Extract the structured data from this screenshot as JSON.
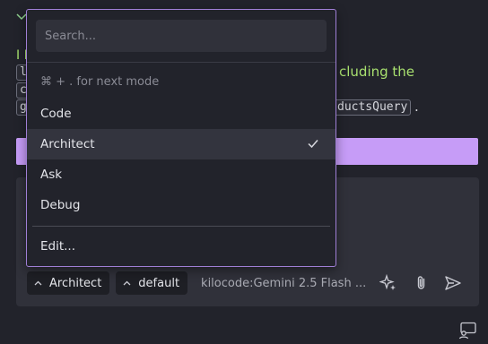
{
  "background": {
    "chevron": "✓",
    "text_line_end": "cluding the",
    "code_chip_tail": "ductsQuery",
    "period": "."
  },
  "composer": {
    "mode_pill": "Architect",
    "profile_pill": "default",
    "model": "kilocode:Gemini 2.5 Flash ..."
  },
  "dropdown": {
    "search_placeholder": "Search...",
    "hint": "⌘ + . for next mode",
    "items": [
      {
        "label": "Code",
        "selected": false
      },
      {
        "label": "Architect",
        "selected": true
      },
      {
        "label": "Ask",
        "selected": false
      },
      {
        "label": "Debug",
        "selected": false
      }
    ],
    "edit_label": "Edit..."
  },
  "colors": {
    "accent_purple": "#c69cf7",
    "dropdown_border": "#a07fd6",
    "green_text": "#a8e06f"
  }
}
